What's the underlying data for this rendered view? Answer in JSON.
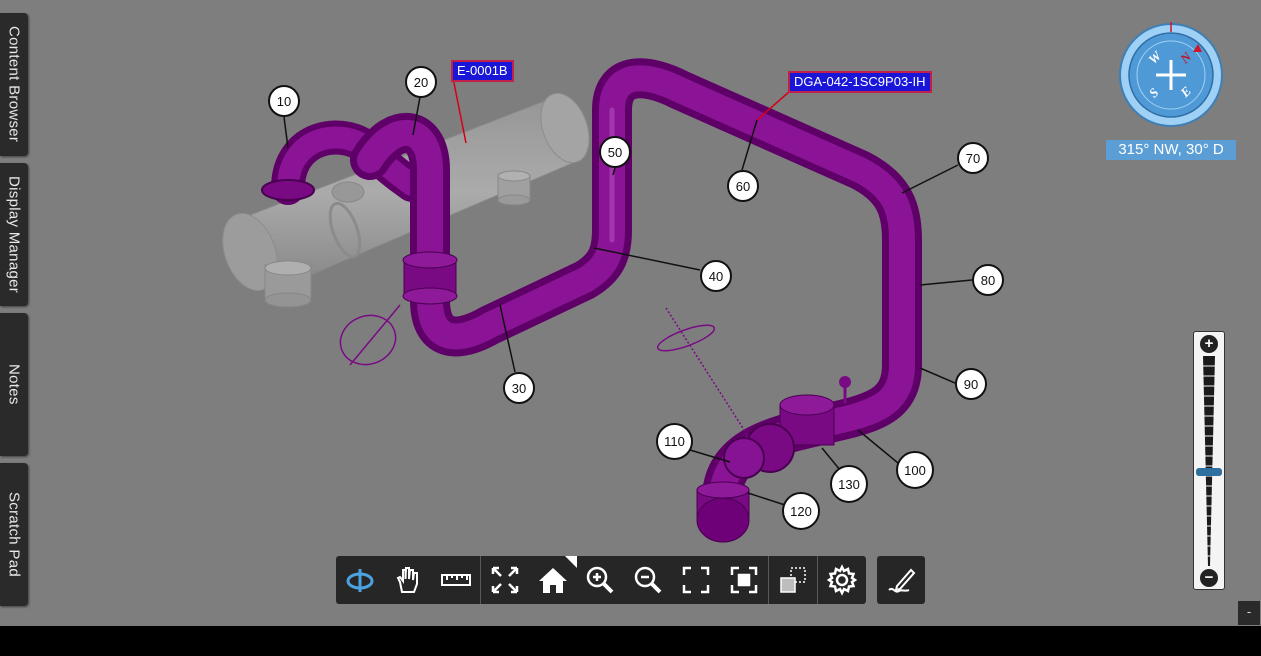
{
  "side_tabs": [
    "Content Browser",
    "Display Manager",
    "Notes",
    "Scratch Pad"
  ],
  "tags": {
    "equipment": "E-0001B",
    "line": "DGA-042-1SC9P03-IH"
  },
  "callouts": [
    "10",
    "20",
    "30",
    "40",
    "50",
    "60",
    "70",
    "80",
    "90",
    "100",
    "110",
    "120",
    "130"
  ],
  "compass": {
    "letters": [
      "N",
      "E",
      "S",
      "W"
    ],
    "orientation": "315° NW, 30° D"
  },
  "zoom": {
    "plus": "+",
    "minus": "−",
    "level": 0.45
  },
  "toolbar": {
    "tools": [
      "orbit-icon",
      "pan-hand-icon",
      "measure-ruler-icon",
      "fit-all-icon",
      "home-icon",
      "zoom-in-icon",
      "zoom-out-icon",
      "fullscreen-icon",
      "focus-selection-icon",
      "transparency-icon",
      "settings-icon"
    ],
    "markup_tool": "markup-pen-icon"
  },
  "collapse_label": "-",
  "colors": {
    "pipe": "#7a0a84",
    "background": "#7e7e7e",
    "tag": "#1a16d8",
    "accent": "#5b9ed6"
  }
}
